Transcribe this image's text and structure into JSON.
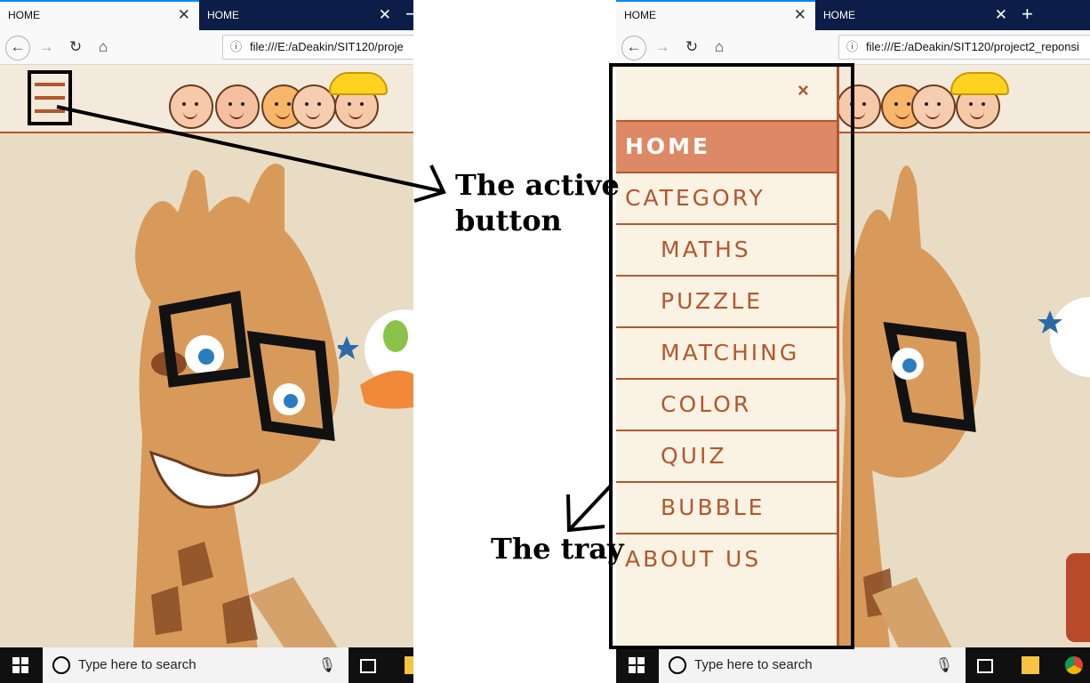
{
  "left_browser": {
    "tabs": [
      {
        "label": "HOME",
        "active": true
      },
      {
        "label": "HOME",
        "active": false
      }
    ],
    "url": "file:///E:/aDeakin/SIT120/proje"
  },
  "right_browser": {
    "tabs": [
      {
        "label": "HOME",
        "active": true
      },
      {
        "label": "HOME",
        "active": false
      }
    ],
    "url": "file:///E:/aDeakin/SIT120/project2_reponsi"
  },
  "tray": {
    "close_glyph": "×",
    "items": [
      {
        "label": "HOME",
        "level": 0,
        "active": true
      },
      {
        "label": "CATEGORY",
        "level": 0,
        "active": false
      },
      {
        "label": "MATHS",
        "level": 1,
        "active": false
      },
      {
        "label": "PUZZLE",
        "level": 1,
        "active": false
      },
      {
        "label": "MATCHING",
        "level": 1,
        "active": false
      },
      {
        "label": "COLOR",
        "level": 1,
        "active": false
      },
      {
        "label": "QUIZ",
        "level": 1,
        "active": false
      },
      {
        "label": "BUBBLE",
        "level": 1,
        "active": false
      },
      {
        "label": "ABOUT US",
        "level": 0,
        "active": false
      }
    ]
  },
  "annotations": {
    "active_button_line1": "The active",
    "active_button_line2": "button",
    "tray_label": "The tray"
  },
  "taskbar": {
    "search_placeholder": "Type here to search"
  },
  "colors": {
    "accent": "#b5562e",
    "active_item_bg": "#dd8965",
    "tray_bg": "#faf3e3",
    "tab_bar": "#0c1e47"
  }
}
